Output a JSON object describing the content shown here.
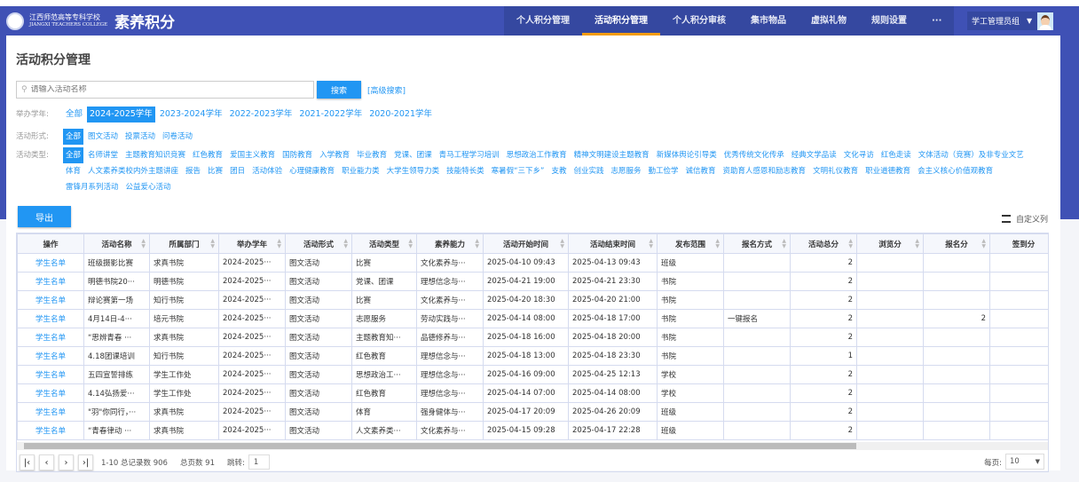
{
  "header": {
    "school": "江西师范高等专科学校",
    "school_en": "JIANGXI TEACHERS COLLEGE",
    "brand": "素养积分",
    "nav": [
      "个人积分管理",
      "活动积分管理",
      "个人积分审核",
      "集市物品",
      "虚拟礼物",
      "规则设置",
      "···"
    ],
    "active_nav": 1,
    "user": "学工管理员组",
    "colors": {
      "primary": "#3f51b5",
      "accent": "#f39c12",
      "link": "#2196f3"
    }
  },
  "page": {
    "title": "活动积分管理",
    "search_placeholder": "请输入活动名称",
    "search_button": "搜索",
    "advanced_search": "[高级搜索]",
    "export": "导出",
    "custom_columns": "自定义列"
  },
  "filters": {
    "year": {
      "label": "举办学年:",
      "options": [
        "全部",
        "2024-2025学年",
        "2023-2024学年",
        "2022-2023学年",
        "2021-2022学年",
        "2020-2021学年"
      ],
      "selected": 1
    },
    "form": {
      "label": "活动形式:",
      "options": [
        "全部",
        "图文活动",
        "投票活动",
        "问卷活动"
      ],
      "selected": 0
    },
    "type": {
      "label": "活动类型:",
      "options": [
        "全部",
        "名师讲堂",
        "主题教育知识竞赛",
        "红色教育",
        "爱国主义教育",
        "国防教育",
        "入学教育",
        "毕业教育",
        "党课、团课",
        "青马工程学习培训",
        "思想政治工作教育",
        "精神文明建设主题教育",
        "新媒体舆论引导类",
        "优秀传统文化传承",
        "经典文学品读",
        "文化寻访",
        "红色走读",
        "文体活动（竞赛）及非专业文艺",
        "体育",
        "人文素养类校内外主题讲座",
        "报告",
        "比赛",
        "团日",
        "活动体验",
        "心理健康教育",
        "职业能力类",
        "大学生领导力类",
        "技能特长类",
        "寒暑假“三下乡”",
        "支教",
        "创业实践",
        "志愿服务",
        "勤工俭学",
        "诚信教育",
        "资助育人感恩和励志教育",
        "文明礼仪教育",
        "职业道德教育",
        "会主义核心价值观教育",
        "雷锋月系列活动",
        "公益爱心活动"
      ],
      "selected": 0
    }
  },
  "table": {
    "columns": [
      "操作",
      "活动名称",
      "所属部门",
      "举办学年",
      "活动形式",
      "活动类型",
      "素养能力",
      "活动开始时间",
      "活动结束时间",
      "发布范围",
      "报名方式",
      "活动总分",
      "浏览分",
      "报名分",
      "签到分"
    ],
    "rows": [
      [
        "学生名单",
        "班级摄影比赛",
        "求真书院",
        "2024-2025···",
        "图文活动",
        "比赛",
        "文化素养与···",
        "2025-04-10 09:43",
        "2025-04-13 09:43",
        "班级",
        "",
        "2",
        "",
        "",
        "2"
      ],
      [
        "学生名单",
        "明德书院20···",
        "明德书院",
        "2024-2025···",
        "图文活动",
        "党课、团课",
        "理想信念与···",
        "2025-04-21 19:00",
        "2025-04-21 23:30",
        "书院",
        "",
        "2",
        "",
        "",
        "2"
      ],
      [
        "学生名单",
        "辩论赛第一场",
        "知行书院",
        "2024-2025···",
        "图文活动",
        "比赛",
        "文化素养与···",
        "2025-04-20 18:30",
        "2025-04-20 21:00",
        "书院",
        "",
        "2",
        "",
        "",
        "2"
      ],
      [
        "学生名单",
        "4月14日-4···",
        "培元书院",
        "2024-2025···",
        "图文活动",
        "志愿服务",
        "劳动实践与···",
        "2025-04-14 08:00",
        "2025-04-18 17:00",
        "书院",
        "一键报名",
        "2",
        "",
        "2",
        ""
      ],
      [
        "学生名单",
        "“思辨青春 ···",
        "求真书院",
        "2024-2025···",
        "图文活动",
        "主题教育知···",
        "品德修养与···",
        "2025-04-18 16:00",
        "2025-04-18 20:00",
        "书院",
        "",
        "2",
        "",
        "",
        "2"
      ],
      [
        "学生名单",
        "4.18团课培训",
        "知行书院",
        "2024-2025···",
        "图文活动",
        "红色教育",
        "理想信念与···",
        "2025-04-18 13:00",
        "2025-04-18 23:30",
        "书院",
        "",
        "1",
        "",
        "",
        "1"
      ],
      [
        "学生名单",
        "五四宣誓排练",
        "学生工作处",
        "2024-2025···",
        "图文活动",
        "思想政治工···",
        "理想信念与···",
        "2025-04-16 09:00",
        "2025-04-25 12:13",
        "学校",
        "",
        "2",
        "",
        "",
        "2"
      ],
      [
        "学生名单",
        "4.14弘扬爱···",
        "学生工作处",
        "2024-2025···",
        "图文活动",
        "红色教育",
        "理想信念与···",
        "2025-04-14 07:00",
        "2025-04-14 08:00",
        "学校",
        "",
        "2",
        "",
        "",
        "2"
      ],
      [
        "学生名单",
        "\"羽\"你同行，···",
        "求真书院",
        "2024-2025···",
        "图文活动",
        "体育",
        "强身健体与···",
        "2025-04-17 20:09",
        "2025-04-26 20:09",
        "班级",
        "",
        "2",
        "",
        "",
        "2"
      ],
      [
        "学生名单",
        "“青春律动 ···",
        "求真书院",
        "2024-2025···",
        "图文活动",
        "人文素养类···",
        "文化素养与···",
        "2025-04-15 09:28",
        "2025-04-17 22:28",
        "班级",
        "",
        "2",
        "",
        "",
        "2"
      ]
    ]
  },
  "pager": {
    "range": "1-10",
    "total_label": "总记录数",
    "total": "906",
    "pages_label": "总页数",
    "pages": "91",
    "jump_label": "跳转:",
    "jump_value": "1",
    "per_page_label": "每页:",
    "per_page": "10"
  }
}
